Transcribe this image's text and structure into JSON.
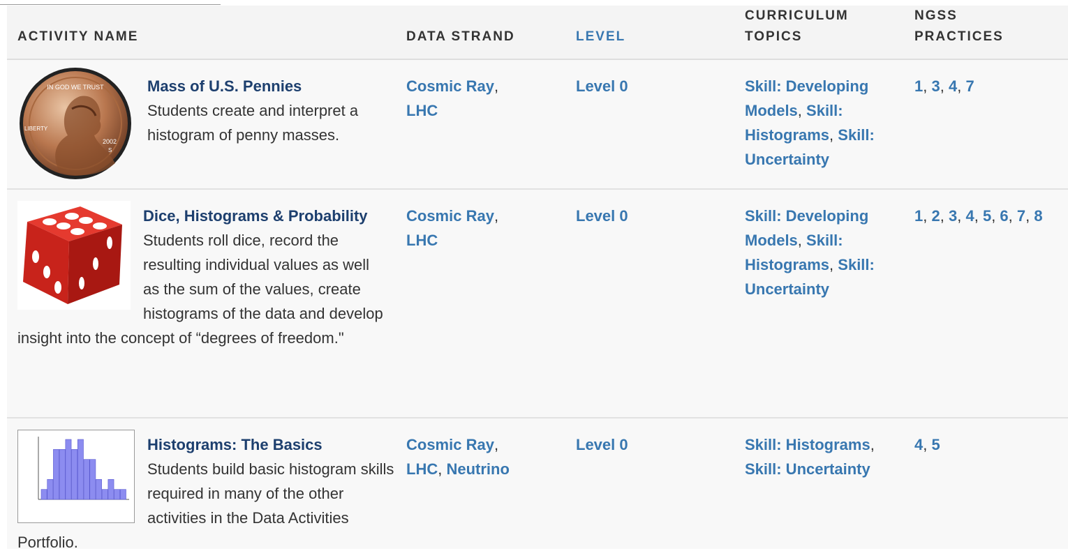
{
  "headers": {
    "activity_name": "ACTIVITY NAME",
    "data_strand": "DATA STRAND",
    "level": "LEVEL",
    "curriculum_1": "CURRICULUM",
    "curriculum_2": "TOPICS",
    "ngss_1": "NGSS",
    "ngss_2": "PRACTICES"
  },
  "rows": [
    {
      "title": "Mass of U.S. Pennies",
      "description": "Students create and interpret a histogram of penny masses.",
      "data_strand": [
        "Cosmic Ray",
        "LHC"
      ],
      "level": "Level 0",
      "topics": [
        "Skill: Developing Models",
        "Skill: Histograms",
        "Skill: Uncertainty"
      ],
      "practices": [
        "1",
        "3",
        "4",
        "7"
      ],
      "coin_text": {
        "motto": "IN GOD WE TRUST",
        "liberty": "LIBERTY",
        "year": "2002",
        "mint": "S"
      }
    },
    {
      "title": "Dice, Histograms & Probability",
      "description": "Students roll dice, record the resulting individual values as well as the sum of the values, create histograms of the data and develop insight into the concept of “degrees of freedom.\"",
      "data_strand": [
        "Cosmic Ray",
        "LHC"
      ],
      "level": "Level 0",
      "topics": [
        "Skill: Developing Models",
        "Skill: Histograms",
        "Skill: Uncertainty"
      ],
      "practices": [
        "1",
        "2",
        "3",
        "4",
        "5",
        "6",
        "7",
        "8"
      ]
    },
    {
      "title": "Histograms: The Basics",
      "description": "Students build basic histogram skills required in many of the other activities in the Data Activities Portfolio.",
      "data_strand": [
        "Cosmic Ray",
        "LHC",
        "Neutrino"
      ],
      "level": "Level 0",
      "topics": [
        "Skill: Histograms",
        "Skill: Uncertainty"
      ],
      "practices": [
        "4",
        "5"
      ],
      "thumbnail_chart": {
        "type": "bar",
        "values": [
          1,
          2,
          5,
          5,
          6,
          5,
          6,
          4,
          4,
          2,
          1,
          2,
          1,
          1
        ]
      }
    }
  ],
  "colors": {
    "link": "#3877b0",
    "title": "#1d3f6e",
    "text": "#333333",
    "die": "#d42a22",
    "bars": "#8c8cf0"
  }
}
